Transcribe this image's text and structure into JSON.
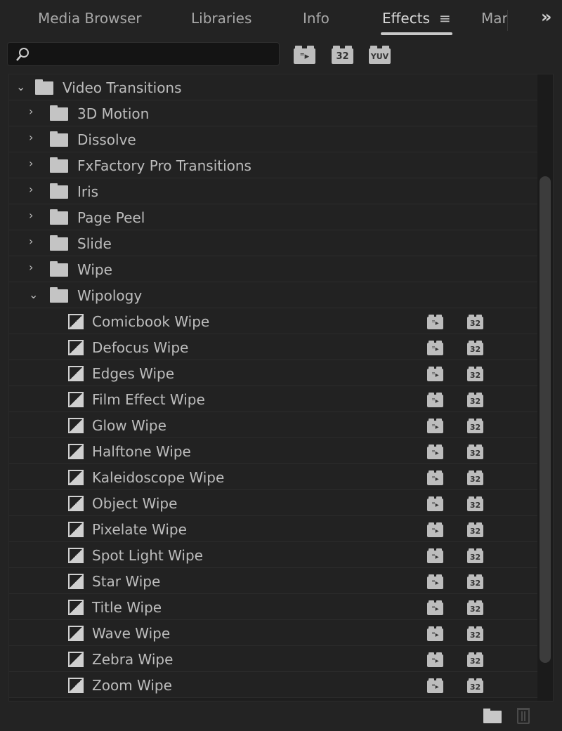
{
  "tabs": [
    {
      "label": "Media Browser",
      "active": false
    },
    {
      "label": "Libraries",
      "active": false
    },
    {
      "label": "Info",
      "active": false
    },
    {
      "label": "Effects",
      "active": true
    },
    {
      "label": "Mar",
      "active": false
    }
  ],
  "overflow_label": "»",
  "menu_icon": "≡",
  "search": {
    "value": "",
    "placeholder": ""
  },
  "filters": {
    "bit32": "32",
    "yuv": "YUV"
  },
  "tree": {
    "root": {
      "label": "Video Transitions",
      "expanded": true
    },
    "folders": [
      {
        "label": "3D Motion",
        "expanded": false
      },
      {
        "label": "Dissolve",
        "expanded": false
      },
      {
        "label": "FxFactory Pro Transitions",
        "expanded": false
      },
      {
        "label": "Iris",
        "expanded": false
      },
      {
        "label": "Page Peel",
        "expanded": false
      },
      {
        "label": "Slide",
        "expanded": false
      },
      {
        "label": "Wipe",
        "expanded": false
      },
      {
        "label": "Wipology",
        "expanded": true
      }
    ],
    "effects": [
      "Comicbook Wipe",
      "Defocus Wipe",
      "Edges Wipe",
      "Film Effect Wipe",
      "Glow Wipe",
      "Halftone Wipe",
      "Kaleidoscope Wipe",
      "Object Wipe",
      "Pixelate Wipe",
      "Spot Light Wipe",
      "Star Wipe",
      "Title Wipe",
      "Wave Wipe",
      "Zebra Wipe",
      "Zoom Wipe"
    ],
    "badge_32": "32"
  }
}
